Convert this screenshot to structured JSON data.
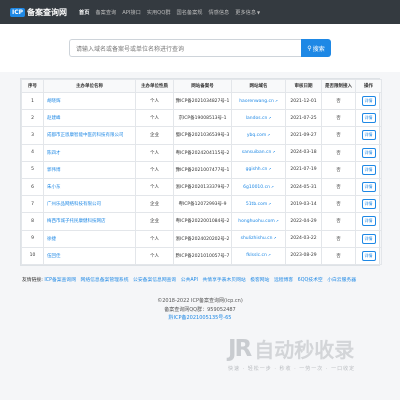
{
  "nav": {
    "brand_logo": "ICP",
    "brand_text": "备案查询网",
    "items": [
      {
        "label": "首页",
        "active": true
      },
      {
        "label": "备案查询",
        "active": false
      },
      {
        "label": "API接口",
        "active": false
      },
      {
        "label": "实用QQ群",
        "active": false
      },
      {
        "label": "国名备案规",
        "active": false
      },
      {
        "label": "情感信息",
        "active": false
      },
      {
        "label": "更多信息",
        "active": false
      }
    ]
  },
  "search": {
    "placeholder": "请输入域名或备案号或单位名称进行查询",
    "button_label": "搜索"
  },
  "table": {
    "headers": [
      "序号",
      "主办单位名称",
      "主办单位性质",
      "网站备案号",
      "网站域名",
      "审核日期",
      "是否限制接入",
      "操作"
    ],
    "rows": [
      {
        "no": "1",
        "name": "胡晓辉",
        "type": "个人",
        "icp": "豫ICP备2021034827号-1",
        "domain": "haorenwang.cn",
        "date": "2021-12-01",
        "limited": "否",
        "action": "详情"
      },
      {
        "no": "2",
        "name": "赵建峰",
        "type": "个人",
        "icp": "京ICP备19008513号-1",
        "domain": "landos.cn",
        "date": "2021-07-25",
        "limited": "否",
        "action": "详情"
      },
      {
        "no": "3",
        "name": "成都市正恩康智能中医药科技有限公司",
        "type": "企业",
        "icp": "蜀ICP备2021036539号-3",
        "domain": "ybq.com",
        "date": "2021-09-27",
        "limited": "否",
        "action": "详情"
      },
      {
        "no": "4",
        "name": "陈四才",
        "type": "个人",
        "icp": "粤ICP备2024204115号-2",
        "domain": "sansuiban.cn",
        "date": "2024-03-18",
        "limited": "否",
        "action": "详情"
      },
      {
        "no": "5",
        "name": "郭伟博",
        "type": "个人",
        "icp": "豫ICP备2021007477号-1",
        "domain": "ggishh.cn",
        "date": "2021-07-19",
        "limited": "否",
        "action": "详情"
      },
      {
        "no": "6",
        "name": "朱小东",
        "type": "个人",
        "icp": "浙ICP备2020133379号-7",
        "domain": "6g10010.cn",
        "date": "2024-05-31",
        "limited": "否",
        "action": "详情"
      },
      {
        "no": "7",
        "name": "广州乐品网络科技有限公司",
        "type": "企业",
        "icp": "粤ICP备12072993号-9",
        "domain": "51tb.com",
        "date": "2019-03-14",
        "limited": "否",
        "action": "详情"
      },
      {
        "no": "8",
        "name": "梅西市城子托民康健科技网店",
        "type": "企业",
        "icp": "粤ICP备2022001084号-2",
        "domain": "honghuohu.com",
        "date": "2022-04-29",
        "limited": "否",
        "action": "详情"
      },
      {
        "no": "9",
        "name": "徐捷",
        "type": "个人",
        "icp": "浙ICP备2024020202号-2",
        "domain": "shulizhishu.cn",
        "date": "2024-03-22",
        "limited": "否",
        "action": "详情"
      },
      {
        "no": "10",
        "name": "伍回佳",
        "type": "个人",
        "icp": "黔ICP备2021010057号-7",
        "domain": "fklsslc.cn",
        "date": "2023-08-29",
        "limited": "否",
        "action": "详情"
      }
    ]
  },
  "friend_links": {
    "label": "友情链接:",
    "items": [
      "ICP备案查询网",
      "网络信息备案管理系统",
      "公安备案信息网查询",
      "公共API",
      "共情享手表木贝网站",
      "极客网站",
      "远程博客",
      "6QQ技术空",
      "小白云服务器"
    ]
  },
  "footer": {
    "copyright": "©2018-2022 ICP备案查询网(icp.cn)",
    "site_name": "备案查询网QQ群：959052487",
    "icp_no": "黔ICP备2021005135号-65"
  },
  "watermark": {
    "logo_text": "JR",
    "title": "自动秒收录",
    "subtitle": "快速 · 轻松一步 · 秒收 · 一劳一次 · 一口收定"
  },
  "colors": {
    "accent": "#1e88e5",
    "nav_bg": "#343a40",
    "page_bg": "#f5f6f8"
  }
}
